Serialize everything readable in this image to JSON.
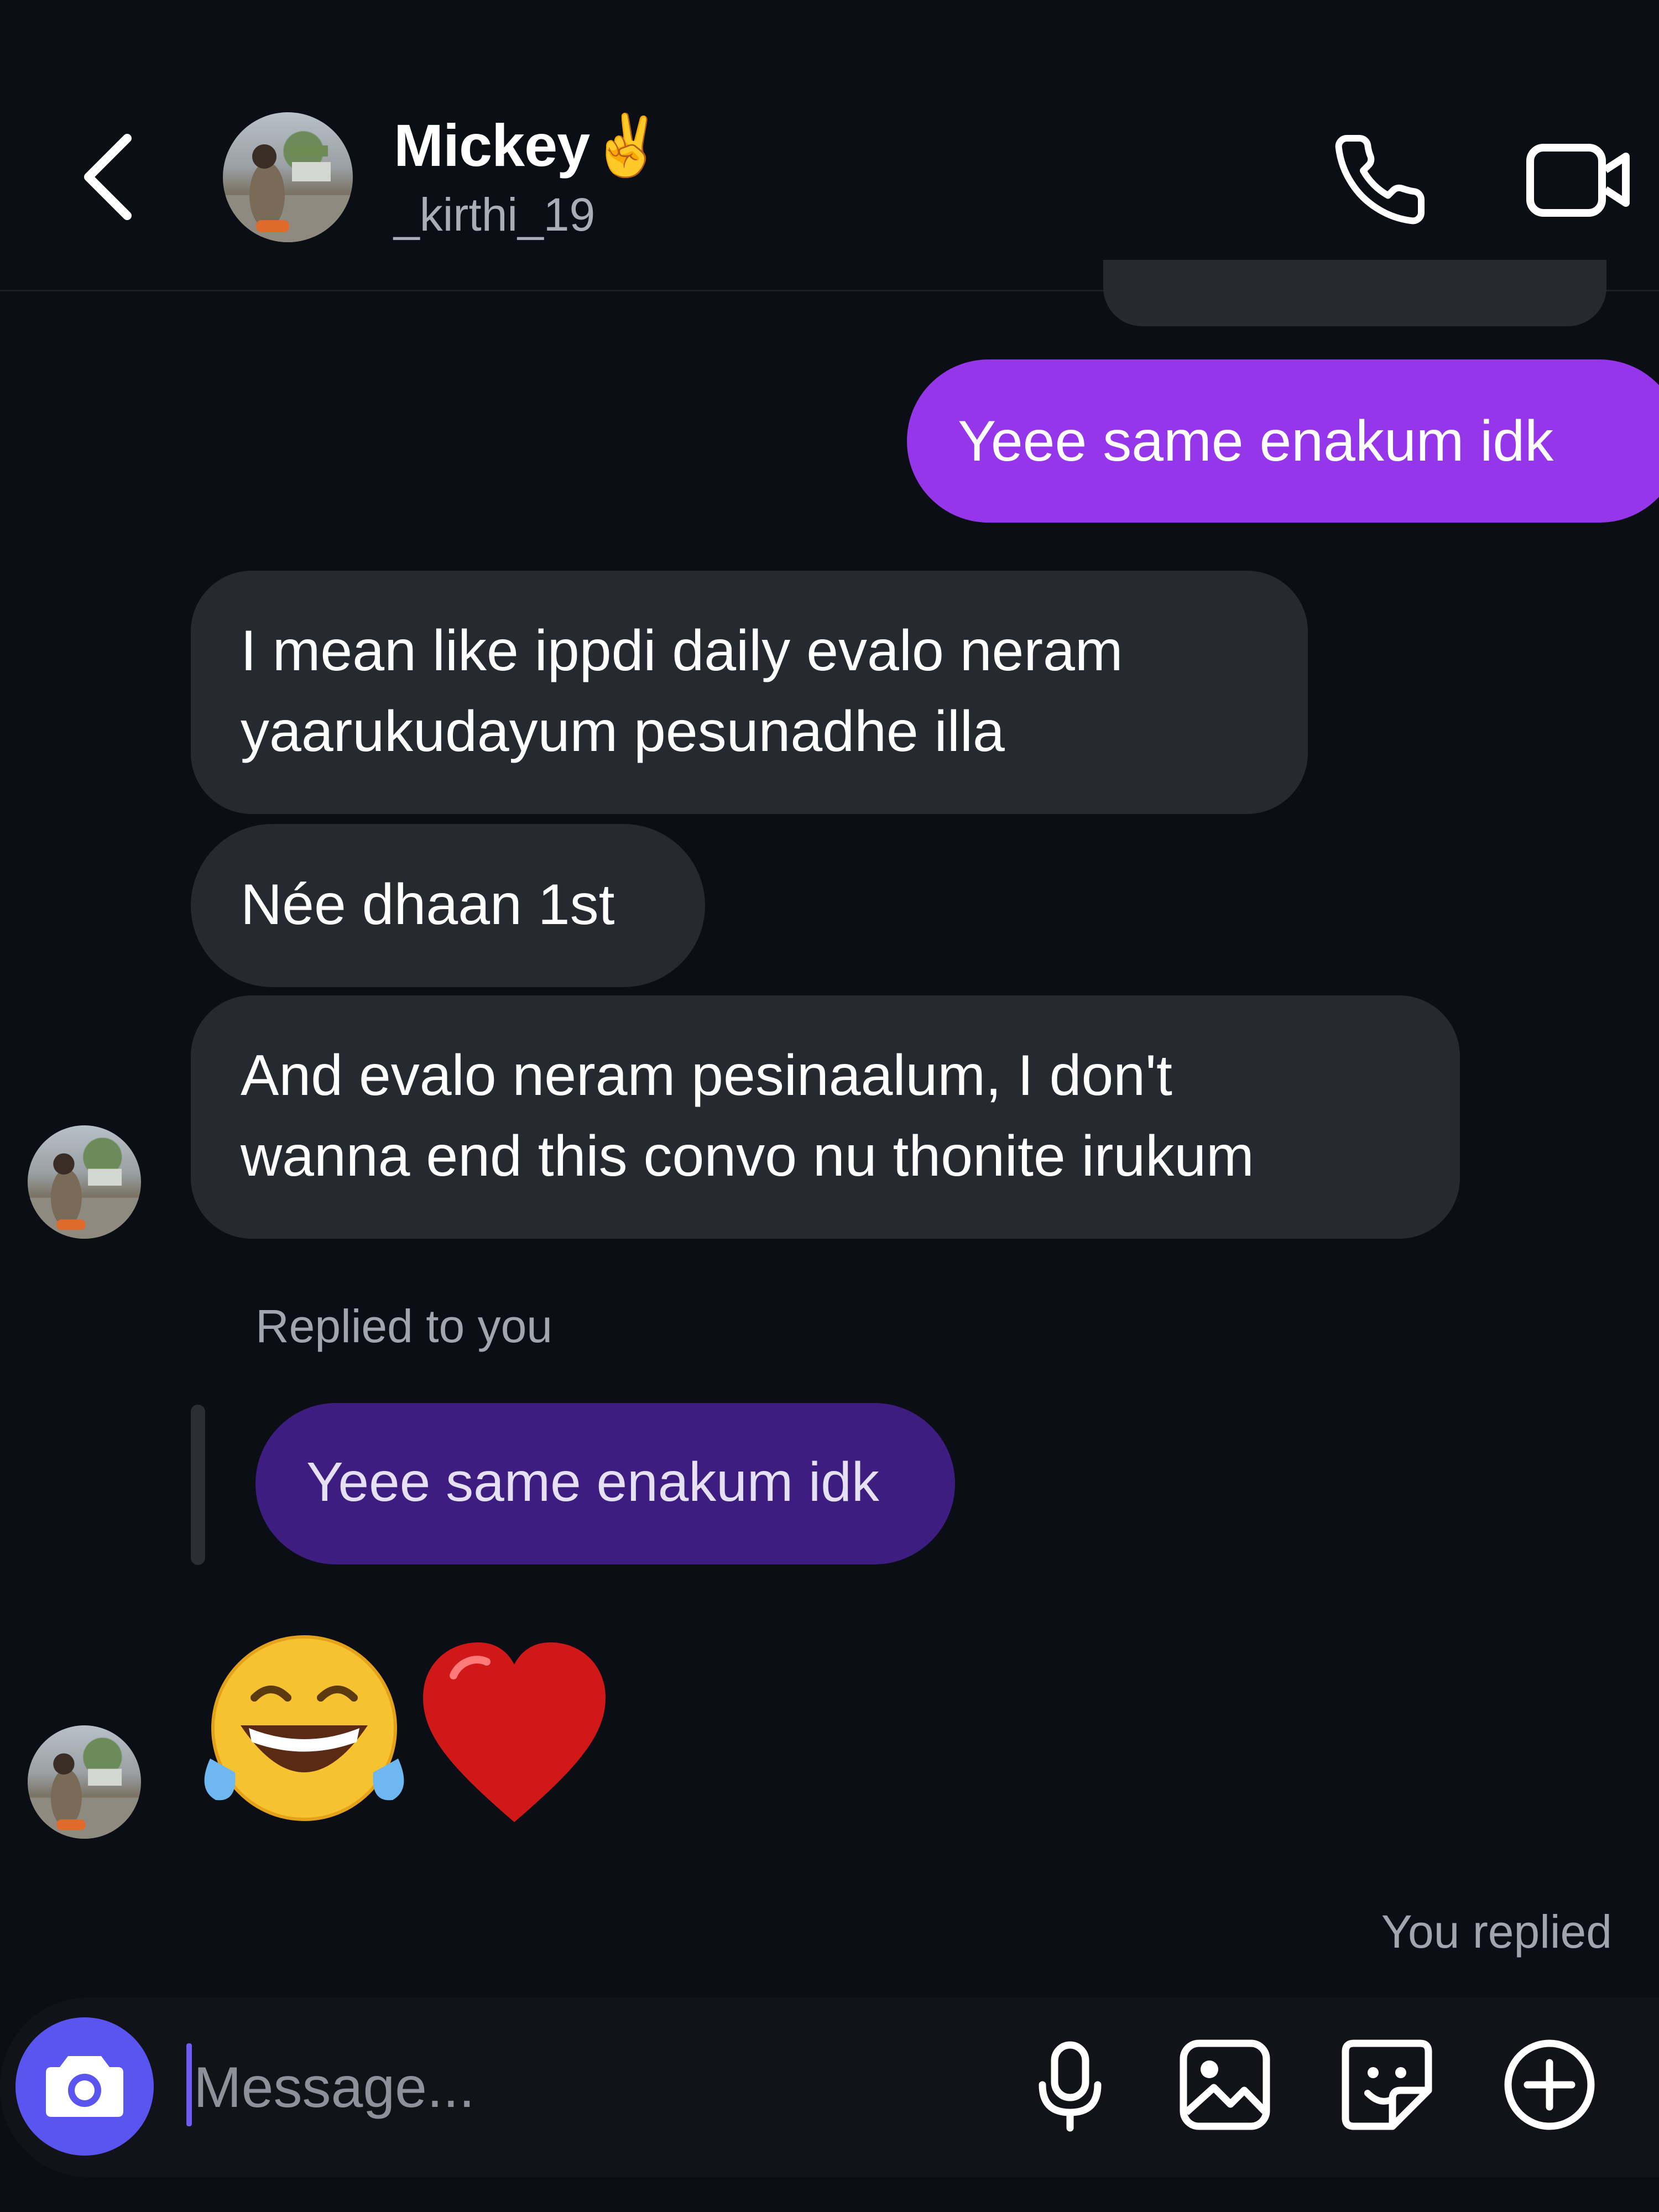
{
  "header": {
    "name": "Mickey✌️",
    "handle": "_kirthi_19",
    "icons": {
      "back": "chevron-left-icon",
      "call": "phone-icon",
      "video": "video-camera-icon"
    }
  },
  "messages": {
    "sent_1": "Yeee same enakum idk",
    "received_1": "I mean like ippdi daily evalo neram\nyaarukudayum pesunadhe illa",
    "received_2": "Née dhaan 1st",
    "received_3": "And evalo neram pesinaalum, I don't\nwanna end this convo nu thonite irukum",
    "reply_label": "Replied to you",
    "quoted_text": "Yeee same enakum idk",
    "you_replied": "You replied"
  },
  "reactions": [
    "laughing-tears-emoji",
    "red-heart-emoji"
  ],
  "composer": {
    "placeholder": "Message...",
    "value": "",
    "icons": [
      "camera-icon",
      "microphone-icon",
      "image-icon",
      "sticker-icon",
      "plus-circle-icon"
    ]
  },
  "colors": {
    "background": "#0b0e14",
    "sent_bubble": "#9536ea",
    "received_bubble": "#262930",
    "quoted_bubble": "#3e1d80",
    "camera_button": "#5a55f0"
  }
}
